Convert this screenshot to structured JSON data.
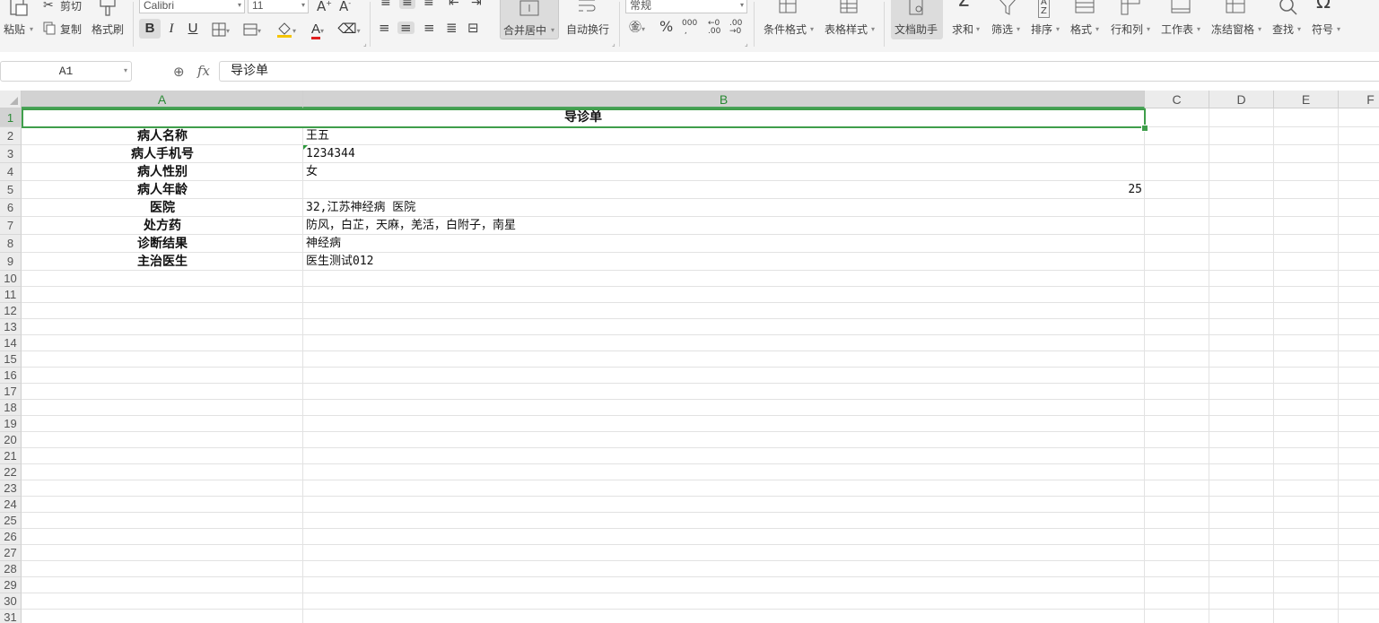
{
  "ribbon": {
    "paste": "粘贴",
    "cut": "剪切",
    "copy": "复制",
    "format_painter": "格式刷",
    "font_name": "Calibri",
    "font_size": "11",
    "merge_center": "合并居中",
    "wrap_text": "自动换行",
    "number_format": "常规",
    "conditional_format": "条件格式",
    "table_style": "表格样式",
    "doc_assistant": "文档助手",
    "sum": "求和",
    "filter": "筛选",
    "sort": "排序",
    "format": "格式",
    "rows_cols": "行和列",
    "worksheet": "工作表",
    "freeze": "冻结窗格",
    "find": "查找",
    "symbol": "符号"
  },
  "formula_bar": {
    "name_box": "A1",
    "fx": "fx",
    "content": "导诊单"
  },
  "columns": [
    "A",
    "B",
    "C",
    "D",
    "E",
    "F"
  ],
  "rows": [
    "1",
    "2",
    "3",
    "4",
    "5",
    "6",
    "7",
    "8",
    "9",
    "10",
    "11",
    "12",
    "13",
    "14",
    "15",
    "16",
    "17",
    "18",
    "19",
    "20",
    "21",
    "22",
    "23",
    "24",
    "25",
    "26",
    "27",
    "28",
    "29",
    "30",
    "31"
  ],
  "sheet": {
    "title": "导诊单",
    "labels": [
      "病人名称",
      "病人手机号",
      "病人性别",
      "病人年龄",
      "医院",
      "处方药",
      "诊断结果",
      "主治医生"
    ],
    "values": [
      "王五",
      "1234344",
      "女",
      "25",
      "32,江苏神经病 医院",
      "防风，白芷，天麻，羌活，白附子，南星",
      "神经病",
      "医生测试012"
    ]
  },
  "colors": {
    "accent": "#3f9e4b",
    "active_tool_bg": "#dcdcdc"
  }
}
